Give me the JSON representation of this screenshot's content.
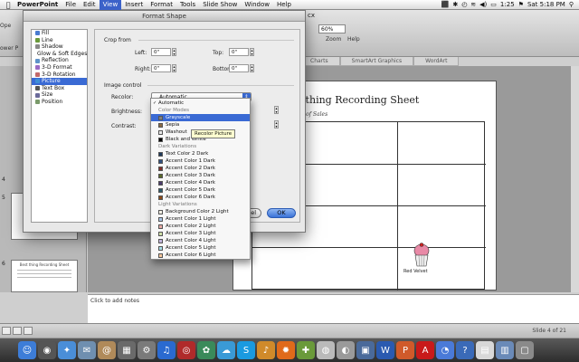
{
  "menubar": {
    "app_name": "PowerPoint",
    "items": [
      "File",
      "Edit",
      "View",
      "Insert",
      "Format",
      "Tools",
      "Slide Show",
      "Window",
      "Help"
    ],
    "active_item": "View",
    "clock": "Sat 5:18 PM",
    "battery": "1:25",
    "apple_icon": "apple-icon"
  },
  "powerpoint": {
    "filename_fragment": "cx",
    "zoom_value": "60%",
    "zoom_label": "Zoom",
    "help_label": "Help",
    "left_fragment_1": "Ope",
    "left_fragment_2": "ower P",
    "ribbon_tabs": [
      "Charts",
      "SmartArt Graphics",
      "WordArt"
    ],
    "thumbnail_numbers": [
      "4",
      "5",
      "6"
    ],
    "thumbnail_title": "Best thing Recording Sheet",
    "slide_title": "st thing Recording Sheet",
    "slide_subtitle": "ber of Sales",
    "cupcake_label": "Red Velvet",
    "notes_placeholder": "Click to add notes",
    "slide_count": "Slide 4 of 21"
  },
  "dialog": {
    "title": "Format Shape",
    "categories": [
      {
        "label": "Fill",
        "color": "#4a7bd0"
      },
      {
        "label": "Line",
        "color": "#6a9a3a"
      },
      {
        "label": "Shadow",
        "color": "#888888"
      },
      {
        "label": "Glow & Soft Edges",
        "color": "#d8a030"
      },
      {
        "label": "Reflection",
        "color": "#5f93c9"
      },
      {
        "label": "3-D Format",
        "color": "#9a6ac4"
      },
      {
        "label": "3-D Rotation",
        "color": "#c46a6a"
      },
      {
        "label": "Picture",
        "color": "#3f8fd6"
      },
      {
        "label": "Text Box",
        "color": "#555555"
      },
      {
        "label": "Size",
        "color": "#6a6a9a"
      },
      {
        "label": "Position",
        "color": "#7a9a6a"
      }
    ],
    "selected_category": "Picture",
    "crop_from": {
      "label": "Crop from",
      "left_label": "Left:",
      "left_value": "0\"",
      "top_label": "Top:",
      "top_value": "0\"",
      "right_label": "Right:",
      "right_value": "0\"",
      "bottom_label": "Bottom:",
      "bottom_value": "0\""
    },
    "image_control": {
      "label": "Image control",
      "recolor_label": "Recolor:",
      "recolor_value": "Automatic",
      "brightness_label": "Brightness:",
      "contrast_label": "Contrast:"
    },
    "cancel_label": "Cancel",
    "ok_label": "OK"
  },
  "recolor_dropdown": {
    "items": [
      {
        "label": "Automatic",
        "kind": "item",
        "checked": true
      },
      {
        "label": "Color Modes",
        "kind": "header"
      },
      {
        "label": "Grayscale",
        "kind": "item",
        "swatch": "#7f7f7f",
        "selected": true
      },
      {
        "label": "Sepia",
        "kind": "item",
        "swatch": "#8a6a44"
      },
      {
        "label": "Washout",
        "kind": "item",
        "swatch": "#e8e8e8"
      },
      {
        "label": "Black and White",
        "kind": "item",
        "swatch": "#000000"
      },
      {
        "label": "Dark Variations",
        "kind": "header"
      },
      {
        "label": "Text Color 2 Dark",
        "kind": "item",
        "swatch": "#1f3a5a"
      },
      {
        "label": "Accent Color 1 Dark",
        "kind": "item",
        "swatch": "#2f4f7f"
      },
      {
        "label": "Accent Color 2 Dark",
        "kind": "item",
        "swatch": "#7f2f2a"
      },
      {
        "label": "Accent Color 3 Dark",
        "kind": "item",
        "swatch": "#5a6a2a"
      },
      {
        "label": "Accent Color 4 Dark",
        "kind": "item",
        "swatch": "#4a3a6a"
      },
      {
        "label": "Accent Color 5 Dark",
        "kind": "item",
        "swatch": "#2a5a6a"
      },
      {
        "label": "Accent Color 6 Dark",
        "kind": "item",
        "swatch": "#8a4a1a"
      },
      {
        "label": "Light Variations",
        "kind": "header"
      },
      {
        "label": "Background Color 2 Light",
        "kind": "item",
        "swatch": "#f2efe4"
      },
      {
        "label": "Accent Color 1 Light",
        "kind": "item",
        "swatch": "#a9c4e6"
      },
      {
        "label": "Accent Color 2 Light",
        "kind": "item",
        "swatch": "#e6aaa6"
      },
      {
        "label": "Accent Color 3 Light",
        "kind": "item",
        "swatch": "#cfe0a8"
      },
      {
        "label": "Accent Color 4 Light",
        "kind": "item",
        "swatch": "#c2b5dc"
      },
      {
        "label": "Accent Color 5 Light",
        "kind": "item",
        "swatch": "#a8dce6"
      },
      {
        "label": "Accent Color 6 Light",
        "kind": "item",
        "swatch": "#f5c79c"
      }
    ],
    "tooltip": "Recolor Picture"
  },
  "dock": {
    "icons": [
      {
        "name": "finder-icon",
        "color": "#3d7dd8",
        "glyph": "☺"
      },
      {
        "name": "dashboard-icon",
        "color": "#555555",
        "glyph": "◉"
      },
      {
        "name": "safari-icon",
        "color": "#4a8ed8",
        "glyph": "✦"
      },
      {
        "name": "mail-icon",
        "color": "#6f8fb0",
        "glyph": "✉"
      },
      {
        "name": "address-book-icon",
        "color": "#b08a5a",
        "glyph": "@"
      },
      {
        "name": "preview-icon",
        "color": "#6a6a6a",
        "glyph": "▦"
      },
      {
        "name": "system-preferences-icon",
        "color": "#7a7a7a",
        "glyph": "⚙"
      },
      {
        "name": "itunes-icon",
        "color": "#2a6ad0",
        "glyph": "♫"
      },
      {
        "name": "photobooth-icon",
        "color": "#b02a2a",
        "glyph": "◎"
      },
      {
        "name": "iphoto-icon",
        "color": "#3a8a5a",
        "glyph": "✿"
      },
      {
        "name": "ichat-icon",
        "color": "#3a9ad6",
        "glyph": "☁"
      },
      {
        "name": "skype-icon",
        "color": "#1a9ae0",
        "glyph": "S"
      },
      {
        "name": "garageband-icon",
        "color": "#d08a2a",
        "glyph": "♪"
      },
      {
        "name": "firefox-icon",
        "color": "#e06a1a",
        "glyph": "✹"
      },
      {
        "name": "app-icon",
        "color": "#6a9a3a",
        "glyph": "✚"
      },
      {
        "name": "cd-icon",
        "color": "#bababa",
        "glyph": "◍"
      },
      {
        "name": "dvd-player-icon",
        "color": "#9a9a9a",
        "glyph": "◐"
      },
      {
        "name": "image-icon",
        "color": "#4a6a9a",
        "glyph": "▣"
      },
      {
        "name": "word-icon",
        "color": "#2a5ab0",
        "glyph": "W"
      },
      {
        "name": "powerpoint-icon",
        "color": "#d05a2a",
        "glyph": "P"
      },
      {
        "name": "acrobat-icon",
        "color": "#c81a1a",
        "glyph": "A"
      },
      {
        "name": "browser-icon",
        "color": "#4a7ad8",
        "glyph": "◔"
      },
      {
        "name": "help-icon",
        "color": "#3a6ab8",
        "glyph": "?"
      },
      {
        "name": "pdf-file-icon",
        "color": "#d8d8d8",
        "glyph": "▤"
      },
      {
        "name": "documents-folder-icon",
        "color": "#6a8ab8",
        "glyph": "▥"
      },
      {
        "name": "trash-icon",
        "color": "#8a8a8a",
        "glyph": "▢"
      }
    ]
  }
}
